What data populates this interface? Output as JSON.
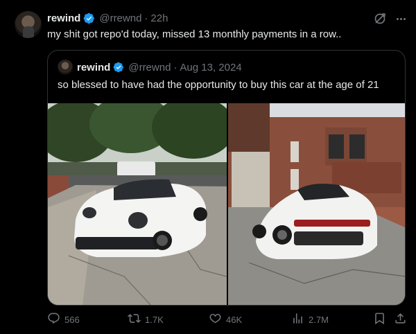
{
  "tweet": {
    "author_name": "rewind",
    "handle": "@rrewnd",
    "separator": "·",
    "time": "22h",
    "text": "my shit got repo'd today, missed 13 monthly payments in a row.."
  },
  "quoted": {
    "author_name": "rewind",
    "handle": "@rrewnd",
    "separator": "·",
    "date": "Aug 13, 2024",
    "text": "so blessed to have had the opportunity to buy this car at the age of 21"
  },
  "actions": {
    "replies": "566",
    "reposts": "1.7K",
    "likes": "46K",
    "views": "2.7M"
  },
  "colors": {
    "background": "#000000",
    "text": "#e7e9ea",
    "muted": "#71767b",
    "verified": "#1d9bf0",
    "border": "#2f3336"
  },
  "icons": [
    "verified-badge-icon",
    "grok-icon",
    "more-icon",
    "reply-icon",
    "repost-icon",
    "like-icon",
    "views-icon",
    "bookmark-icon",
    "share-icon"
  ]
}
